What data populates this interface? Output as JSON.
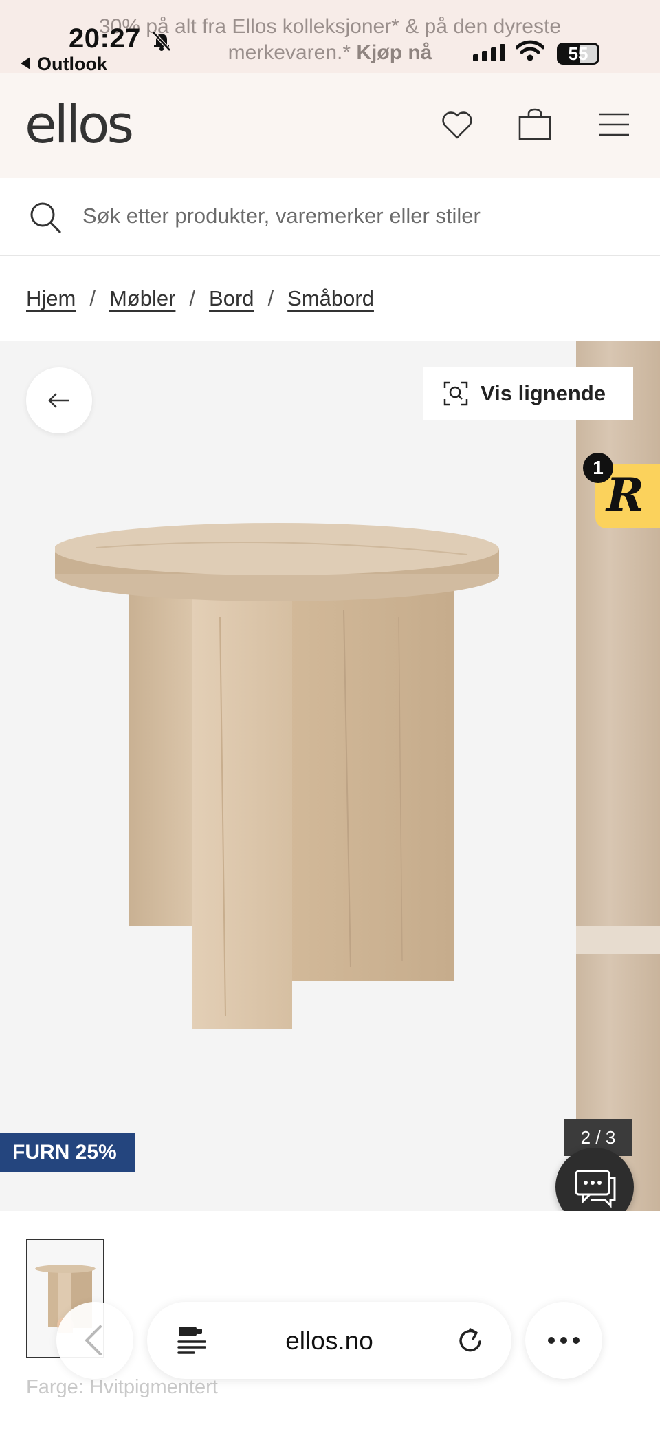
{
  "status_bar": {
    "time": "20:27",
    "back_app": "Outlook",
    "battery": "55"
  },
  "promo_banner": {
    "text": "30% på alt fra Ellos kolleksjoner* & på den dyreste merkevaren.*",
    "cta": "Kjøp nå"
  },
  "header": {
    "logo": "ellos",
    "icons": [
      "heart-icon",
      "shopping-bag-icon",
      "menu-icon"
    ]
  },
  "search": {
    "placeholder": "Søk etter produkter, varemerker eller stiler"
  },
  "breadcrumb": {
    "items": [
      "Hjem",
      "Møbler",
      "Bord",
      "Småbord"
    ],
    "separator": "/"
  },
  "gallery": {
    "similar_button": "Vis lignende",
    "badge_count": "1",
    "badge_letter": "R",
    "promo_tag": "FURN 25%",
    "current": "2",
    "counter_sep": "/",
    "total": "3"
  },
  "product": {
    "color_label": "Farge: Hvitpigmentert"
  },
  "browser": {
    "url": "ellos.no"
  },
  "colors": {
    "header_bg": "#faf5f2",
    "promo_bg": "#f7ece8",
    "promo_tag_bg": "#24457e",
    "badge_bg": "#fbd25c"
  }
}
